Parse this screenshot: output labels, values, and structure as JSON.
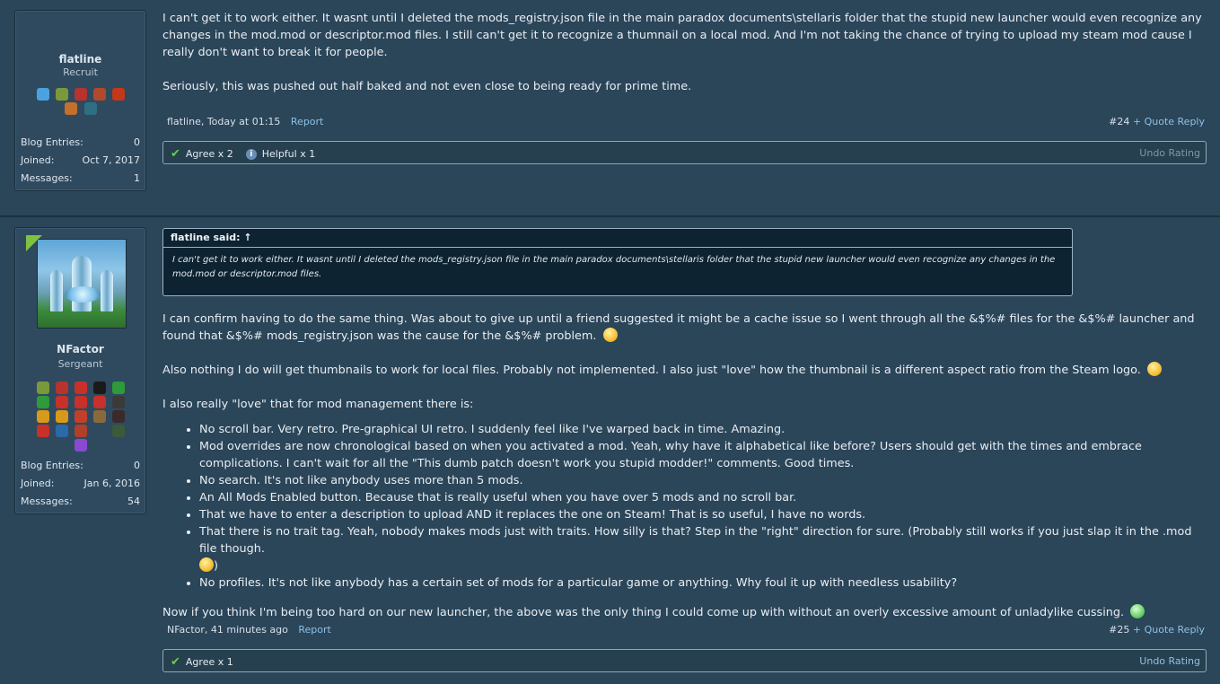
{
  "posts": [
    {
      "user": {
        "name": "flatline",
        "title": "Recruit",
        "stats": [
          {
            "label": "Blog Entries:",
            "value": "0"
          },
          {
            "label": "Joined:",
            "value": "Oct 7, 2017"
          },
          {
            "label": "Messages:",
            "value": "1"
          }
        ]
      },
      "paragraphs": [
        "I can't get it to work either. It wasnt until I deleted the mods_registry.json file in the main paradox documents\\stellaris folder that the stupid new launcher would even recognize any changes in the mod.mod or descriptor.mod files. I still can't get it to recognize a thumnail on a local mod. And I'm not taking the chance of trying to upload my steam mod cause I really don't want to break it for people.",
        "Seriously, this was pushed out half baked and not even close to being ready for prime time."
      ],
      "meta": {
        "author": "flatline",
        "time": ", Today at 01:15",
        "report": "Report",
        "number": "#24",
        "quote": "+ Quote",
        "reply": "Reply"
      },
      "ratings": {
        "agree": "Agree x 2",
        "helpful": "Helpful x 1",
        "undo": "Undo Rating"
      }
    },
    {
      "user": {
        "name": "NFactor",
        "title": "Sergeant",
        "stats": [
          {
            "label": "Blog Entries:",
            "value": "0"
          },
          {
            "label": "Joined:",
            "value": "Jan 6, 2016"
          },
          {
            "label": "Messages:",
            "value": "54"
          }
        ]
      },
      "quote": {
        "header": "flatline said: ↑",
        "text": "I can't get it to work either. It wasnt until I deleted the mods_registry.json file in the main paradox documents\\stellaris folder that the stupid new launcher would even recognize any changes in the mod.mod or descriptor.mod files."
      },
      "p1": "I can confirm having to do the same thing. Was about to give up until a friend suggested it might be a cache issue so I went through all the &$%# files for the &$%# launcher and found that &$%# mods_registry.json was the cause for the &$%# problem.",
      "p2": "Also nothing I do will get thumbnails to work for local files. Probably not implemented. I also just \"love\" how the thumbnail is a different aspect ratio from the Steam logo.",
      "p3": "I also really \"love\" that for mod management there is:",
      "list": [
        "No scroll bar. Very retro. Pre-graphical UI retro. I suddenly feel like I've warped back in time. Amazing.",
        "Mod overrides are now chronological based on when you activated a mod. Yeah, why have it alphabetical like before? Users should get with the times and embrace complications. I can't wait for all the \"This dumb patch doesn't work you stupid modder!\" comments. Good times.",
        "No search. It's not like anybody uses more than 5 mods.",
        "An All Mods Enabled button. Because that is really useful when you have over 5 mods and no scroll bar.",
        "That we have to enter a description to upload AND it replaces the one on Steam! That is so useful, I have no words.",
        "That there is no trait tag. Yeah, nobody makes mods just with traits. How silly is that? Step in the \"right\" direction for sure. (Probably still works if you just slap it in the .mod file though.",
        "No profiles. It's not like anybody has a certain set of mods for a particular game or anything. Why foul it up with needless usability?"
      ],
      "list_tail": ")",
      "p4": "Now if you think I'm being too hard on our new launcher, the above was the only thing I could come up with without an overly excessive amount of unladylike cussing.",
      "meta": {
        "author": "NFactor",
        "time": ", 41 minutes ago",
        "report": "Report",
        "number": "#25",
        "quote": "+ Quote",
        "reply": "Reply"
      },
      "ratings": {
        "agree": "Agree x 1",
        "undo": "Undo Rating"
      }
    }
  ],
  "colors": {
    "link": "#8ec0e4",
    "background": "#2b4559",
    "check": "#5fd14a"
  }
}
